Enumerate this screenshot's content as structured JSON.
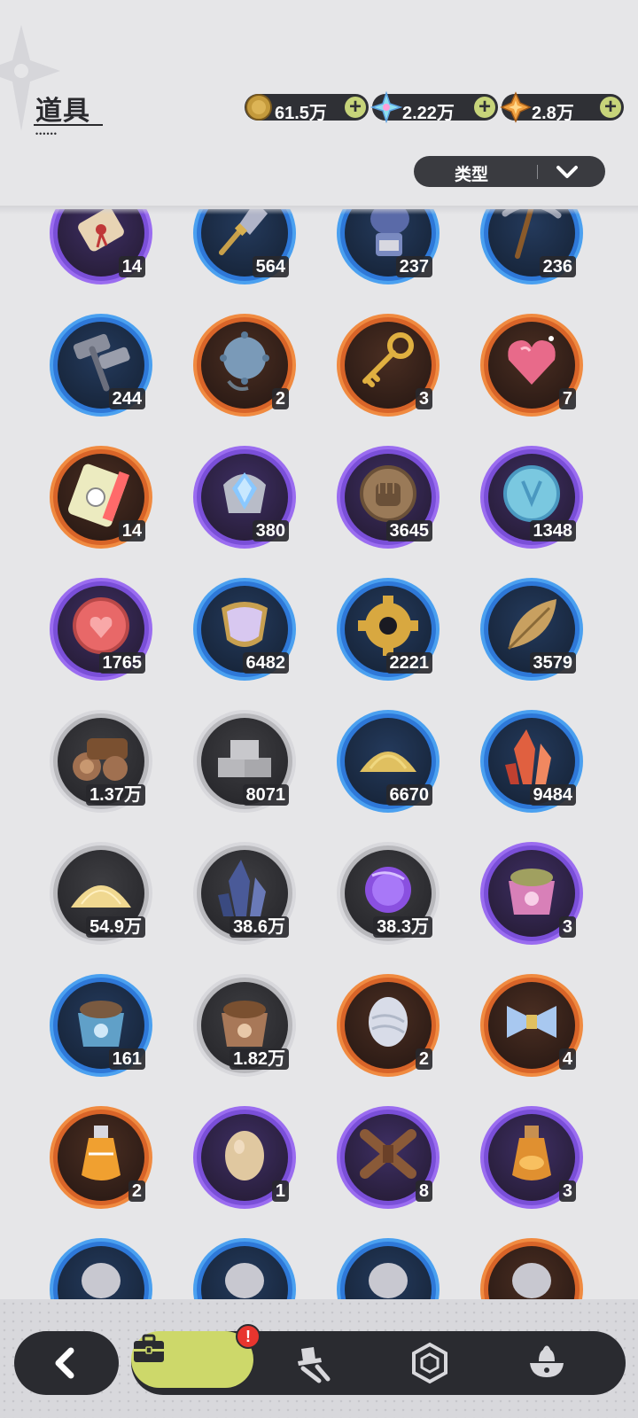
{
  "header": {
    "title": "道具",
    "title_dots": "••••••",
    "currencies": [
      {
        "name": "gold-coin",
        "value": "61.5万"
      },
      {
        "name": "crystal",
        "value": "2.22万"
      },
      {
        "name": "star-gem",
        "value": "2.8万"
      }
    ],
    "filter_label": "类型"
  },
  "items": [
    {
      "icon": "scroll-icon",
      "rarity": "purple",
      "count": "14"
    },
    {
      "icon": "shovel-icon",
      "rarity": "blue",
      "count": "564"
    },
    {
      "icon": "glove-icon",
      "rarity": "blue",
      "count": "237"
    },
    {
      "icon": "pickaxe-icon",
      "rarity": "blue",
      "count": "236"
    },
    {
      "icon": "hammer-icon",
      "rarity": "blue",
      "count": "244"
    },
    {
      "icon": "spiked-ball-icon",
      "rarity": "orange",
      "count": "2"
    },
    {
      "icon": "key-icon",
      "rarity": "orange",
      "count": "3"
    },
    {
      "icon": "heart-gem-icon",
      "rarity": "orange",
      "count": "7"
    },
    {
      "icon": "ticket-icon",
      "rarity": "orange",
      "count": "14"
    },
    {
      "icon": "crystal-crest-icon",
      "rarity": "purple",
      "count": "380"
    },
    {
      "icon": "fist-coin-icon",
      "rarity": "purple",
      "count": "3645"
    },
    {
      "icon": "blue-coin-icon",
      "rarity": "purple",
      "count": "1348"
    },
    {
      "icon": "heart-coin-icon",
      "rarity": "purple",
      "count": "1765"
    },
    {
      "icon": "scale-shell-icon",
      "rarity": "blue",
      "count": "6482"
    },
    {
      "icon": "gear-icon",
      "rarity": "blue",
      "count": "2221"
    },
    {
      "icon": "leaf-icon",
      "rarity": "blue",
      "count": "3579"
    },
    {
      "icon": "wood-logs-icon",
      "rarity": "grey",
      "count": "1.37万"
    },
    {
      "icon": "stone-bricks-icon",
      "rarity": "grey",
      "count": "8071"
    },
    {
      "icon": "gold-sand-icon",
      "rarity": "blue",
      "count": "6670"
    },
    {
      "icon": "red-crystal-icon",
      "rarity": "blue",
      "count": "9484"
    },
    {
      "icon": "sand-pile-icon",
      "rarity": "grey",
      "count": "54.9万"
    },
    {
      "icon": "dark-crystal-icon",
      "rarity": "grey",
      "count": "38.6万"
    },
    {
      "icon": "purple-orb-icon",
      "rarity": "grey",
      "count": "38.3万"
    },
    {
      "icon": "pink-food-bag-icon",
      "rarity": "purple",
      "count": "3"
    },
    {
      "icon": "blue-food-bag-icon",
      "rarity": "blue",
      "count": "161"
    },
    {
      "icon": "brown-food-bag-icon",
      "rarity": "grey",
      "count": "1.82万"
    },
    {
      "icon": "egg-icon",
      "rarity": "orange",
      "count": "2"
    },
    {
      "icon": "bandage-icon",
      "rarity": "orange",
      "count": "4"
    },
    {
      "icon": "orange-potion-icon",
      "rarity": "orange",
      "count": "2"
    },
    {
      "icon": "plain-egg-icon",
      "rarity": "purple",
      "count": "1"
    },
    {
      "icon": "rope-bundle-icon",
      "rarity": "purple",
      "count": "8"
    },
    {
      "icon": "amber-potion-icon",
      "rarity": "purple",
      "count": "3"
    },
    {
      "icon": "partial-item-icon",
      "rarity": "blue",
      "count": ""
    },
    {
      "icon": "partial-item-icon",
      "rarity": "blue",
      "count": ""
    },
    {
      "icon": "partial-item-icon",
      "rarity": "blue",
      "count": ""
    },
    {
      "icon": "partial-item-icon",
      "rarity": "orange",
      "count": ""
    }
  ],
  "nav": {
    "badge": "!",
    "tabs": [
      {
        "name": "bag-tab",
        "active": true
      },
      {
        "name": "character-tab",
        "active": false
      },
      {
        "name": "hexagon-gem-tab",
        "active": false
      },
      {
        "name": "food-tab",
        "active": false
      }
    ]
  },
  "colors": {
    "purple": "#7a4fd8",
    "blue": "#2e78d8",
    "orange": "#d86428",
    "grey": "#b8b8bc",
    "accent": "#cdd86a",
    "badge": "#e8352e"
  }
}
